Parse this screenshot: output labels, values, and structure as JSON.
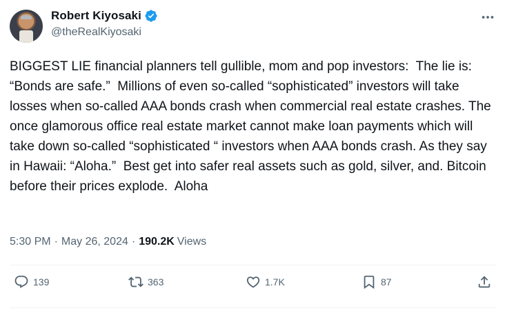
{
  "author": {
    "display_name": "Robert Kiyosaki",
    "handle": "@theRealKiyosaki",
    "verified": true
  },
  "tweet": {
    "text": "BIGGEST LIE financial planners tell gullible, mom and pop investors:  The lie is: “Bonds are safe.”  Millions of even so-called “sophisticated” investors will take losses when so-called AAA bonds crash when commercial real estate crashes. The once glamorous office real estate market cannot make loan payments which will take down so-called “sophisticated “ investors when AAA bonds crash. As they say in Hawaii: “Aloha.”  Best get into safer real assets such as gold, silver, and. Bitcoin before their prices explode.  Aloha",
    "time": "5:30 PM",
    "date": "May 26, 2024",
    "views_count": "190.2K",
    "views_label": "Views"
  },
  "actions": {
    "replies": "139",
    "reposts": "363",
    "likes": "1.7K",
    "bookmarks": "87"
  },
  "icons": {
    "verified": "verified-badge-icon",
    "more": "more-options-icon",
    "reply": "reply-icon",
    "repost": "repost-icon",
    "like": "heart-icon",
    "bookmark": "bookmark-icon",
    "share": "share-icon"
  },
  "colors": {
    "verified_badge": "#1d9bf0",
    "secondary_text": "#536471",
    "primary_text": "#0f1419"
  }
}
